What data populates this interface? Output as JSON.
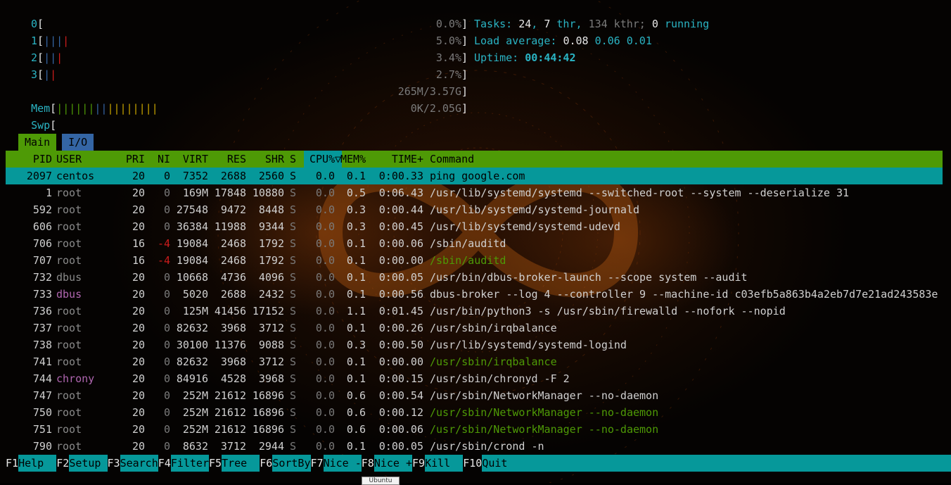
{
  "meters": {
    "cpus": [
      {
        "id": "0",
        "pct": "0.0%",
        "bars": ""
      },
      {
        "id": "1",
        "pct": "5.0%",
        "bars": "|||"
      },
      {
        "id": "2",
        "pct": "3.4%",
        "bars": "||"
      },
      {
        "id": "3",
        "pct": "2.7%",
        "bars": "|"
      }
    ],
    "cpu_bars_red": [
      "",
      "|",
      "|",
      "|"
    ],
    "mem": {
      "label": "Mem",
      "value": "265M/3.57G",
      "bars_green": "||||||",
      "bars_blue": "||",
      "bars_yellow": "||||||||"
    },
    "swp": {
      "label": "Swp",
      "value": "0K/2.05G"
    }
  },
  "summary": {
    "tasks_label": "Tasks:",
    "tasks": "24",
    "thr": "7",
    "thr_label": "thr,",
    "kthr": "134 kthr;",
    "running": "0",
    "running_label": "running",
    "load_label": "Load average:",
    "load1": "0.08",
    "load5": "0.06",
    "load15": "0.01",
    "uptime_label": "Uptime:",
    "uptime": "00:44:42"
  },
  "tabs": {
    "main": "Main",
    "io": "I/O"
  },
  "columns": {
    "pid": "PID",
    "user": "USER",
    "pri": "PRI",
    "ni": "NI",
    "virt": "VIRT",
    "res": "RES",
    "shr": "SHR",
    "s": "S",
    "cpu": "CPU%▽",
    "mem": "MEM%",
    "time": "TIME+",
    "cmd": "Command"
  },
  "processes": [
    {
      "pid": "2097",
      "user": "centos",
      "pri": "20",
      "ni": "0",
      "virt": "7352",
      "res": "2688",
      "shr": "2560",
      "s": "S",
      "cpu": "0.0",
      "mem": "0.1",
      "time": "0:00.33",
      "cmd": "ping google.com",
      "selected": true
    },
    {
      "pid": "1",
      "user": "root",
      "pri": "20",
      "ni": "0",
      "virt": "169M",
      "res": "17848",
      "shr": "10880",
      "s": "S",
      "cpu": "0.0",
      "mem": "0.5",
      "time": "0:06.43",
      "cmd": "/usr/lib/systemd/systemd --switched-root --system --deserialize 31"
    },
    {
      "pid": "592",
      "user": "root",
      "pri": "20",
      "ni": "0",
      "virt": "27548",
      "res": "9472",
      "shr": "8448",
      "s": "S",
      "cpu": "0.0",
      "mem": "0.3",
      "time": "0:00.44",
      "cmd": "/usr/lib/systemd/systemd-journald"
    },
    {
      "pid": "606",
      "user": "root",
      "pri": "20",
      "ni": "0",
      "virt": "36384",
      "res": "11988",
      "shr": "9344",
      "s": "S",
      "cpu": "0.0",
      "mem": "0.3",
      "time": "0:00.45",
      "cmd": "/usr/lib/systemd/systemd-udevd"
    },
    {
      "pid": "706",
      "user": "root",
      "pri": "16",
      "ni": "-4",
      "virt": "19084",
      "res": "2468",
      "shr": "1792",
      "s": "S",
      "cpu": "0.0",
      "mem": "0.1",
      "time": "0:00.06",
      "cmd": "/sbin/auditd"
    },
    {
      "pid": "707",
      "user": "root",
      "pri": "16",
      "ni": "-4",
      "virt": "19084",
      "res": "2468",
      "shr": "1792",
      "s": "S",
      "cpu": "0.0",
      "mem": "0.1",
      "time": "0:00.00",
      "cmd": "/sbin/auditd",
      "thread": true
    },
    {
      "pid": "732",
      "user": "dbus",
      "pri": "20",
      "ni": "0",
      "virt": "10668",
      "res": "4736",
      "shr": "4096",
      "s": "S",
      "cpu": "0.0",
      "mem": "0.1",
      "time": "0:00.05",
      "cmd": "/usr/bin/dbus-broker-launch --scope system --audit"
    },
    {
      "pid": "733",
      "user": "dbus",
      "pri": "20",
      "ni": "0",
      "virt": "5020",
      "res": "2688",
      "shr": "2432",
      "s": "S",
      "cpu": "0.0",
      "mem": "0.1",
      "time": "0:00.56",
      "cmd": "dbus-broker --log 4 --controller 9 --machine-id c03efb5a863b4a2eb7d7e21ad243583e",
      "user_color": "purple"
    },
    {
      "pid": "736",
      "user": "root",
      "pri": "20",
      "ni": "0",
      "virt": "125M",
      "res": "41456",
      "shr": "17152",
      "s": "S",
      "cpu": "0.0",
      "mem": "1.1",
      "time": "0:01.45",
      "cmd": "/usr/bin/python3 -s /usr/sbin/firewalld --nofork --nopid"
    },
    {
      "pid": "737",
      "user": "root",
      "pri": "20",
      "ni": "0",
      "virt": "82632",
      "res": "3968",
      "shr": "3712",
      "s": "S",
      "cpu": "0.0",
      "mem": "0.1",
      "time": "0:00.26",
      "cmd": "/usr/sbin/irqbalance"
    },
    {
      "pid": "738",
      "user": "root",
      "pri": "20",
      "ni": "0",
      "virt": "30100",
      "res": "11376",
      "shr": "9088",
      "s": "S",
      "cpu": "0.0",
      "mem": "0.3",
      "time": "0:00.50",
      "cmd": "/usr/lib/systemd/systemd-logind"
    },
    {
      "pid": "741",
      "user": "root",
      "pri": "20",
      "ni": "0",
      "virt": "82632",
      "res": "3968",
      "shr": "3712",
      "s": "S",
      "cpu": "0.0",
      "mem": "0.1",
      "time": "0:00.00",
      "cmd": "/usr/sbin/irqbalance",
      "thread": true
    },
    {
      "pid": "744",
      "user": "chrony",
      "pri": "20",
      "ni": "0",
      "virt": "84916",
      "res": "4528",
      "shr": "3968",
      "s": "S",
      "cpu": "0.0",
      "mem": "0.1",
      "time": "0:00.15",
      "cmd": "/usr/sbin/chronyd -F 2",
      "user_color": "purple"
    },
    {
      "pid": "747",
      "user": "root",
      "pri": "20",
      "ni": "0",
      "virt": "252M",
      "res": "21612",
      "shr": "16896",
      "s": "S",
      "cpu": "0.0",
      "mem": "0.6",
      "time": "0:00.54",
      "cmd": "/usr/sbin/NetworkManager --no-daemon"
    },
    {
      "pid": "750",
      "user": "root",
      "pri": "20",
      "ni": "0",
      "virt": "252M",
      "res": "21612",
      "shr": "16896",
      "s": "S",
      "cpu": "0.0",
      "mem": "0.6",
      "time": "0:00.12",
      "cmd": "/usr/sbin/NetworkManager --no-daemon",
      "thread": true
    },
    {
      "pid": "751",
      "user": "root",
      "pri": "20",
      "ni": "0",
      "virt": "252M",
      "res": "21612",
      "shr": "16896",
      "s": "S",
      "cpu": "0.0",
      "mem": "0.6",
      "time": "0:00.06",
      "cmd": "/usr/sbin/NetworkManager --no-daemon",
      "thread": true
    },
    {
      "pid": "790",
      "user": "root",
      "pri": "20",
      "ni": "0",
      "virt": "8632",
      "res": "3712",
      "shr": "2944",
      "s": "S",
      "cpu": "0.0",
      "mem": "0.1",
      "time": "0:00.05",
      "cmd": "/usr/sbin/crond -n"
    }
  ],
  "fkeys": [
    {
      "key": "F1",
      "label": "Help  "
    },
    {
      "key": "F2",
      "label": "Setup "
    },
    {
      "key": "F3",
      "label": "Search"
    },
    {
      "key": "F4",
      "label": "Filter"
    },
    {
      "key": "F5",
      "label": "Tree  "
    },
    {
      "key": "F6",
      "label": "SortBy"
    },
    {
      "key": "F7",
      "label": "Nice -"
    },
    {
      "key": "F8",
      "label": "Nice +"
    },
    {
      "key": "F9",
      "label": "Kill  "
    },
    {
      "key": "F10",
      "label": "Quit"
    }
  ],
  "tooltip": "Ubuntu",
  "colors": {
    "cyan": "#06989a",
    "green": "#4e9a06",
    "blue": "#3465a4",
    "red": "#cc1c1c",
    "purple": "#b066b0"
  }
}
